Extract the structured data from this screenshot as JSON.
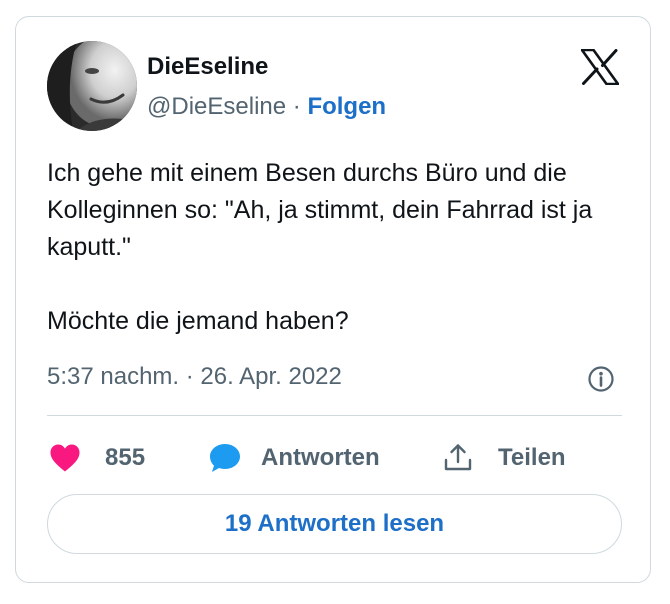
{
  "author": {
    "display_name": "DieEseline",
    "handle": "@DieEseline",
    "separator": "·",
    "follow_label": "Folgen"
  },
  "platform_icon": "x-logo-icon",
  "tweet": {
    "text": "Ich gehe mit einem Besen durchs Büro und die Kolleginnen so: \"Ah, ja stimmt, dein Fahrrad ist ja kaputt.\"\n\nMöchte die jemand haben?",
    "timestamp": "5:37 nachm. · 26. Apr. 2022"
  },
  "actions": {
    "like_count": "855",
    "reply_label": "Antworten",
    "share_label": "Teilen"
  },
  "read_replies_label": "19 Antworten lesen",
  "colors": {
    "link": "#1d6fc7",
    "heart": "#f91880",
    "reply_bubble": "#1d9bf0",
    "muted_text": "#536471",
    "border": "#cfd9de"
  }
}
